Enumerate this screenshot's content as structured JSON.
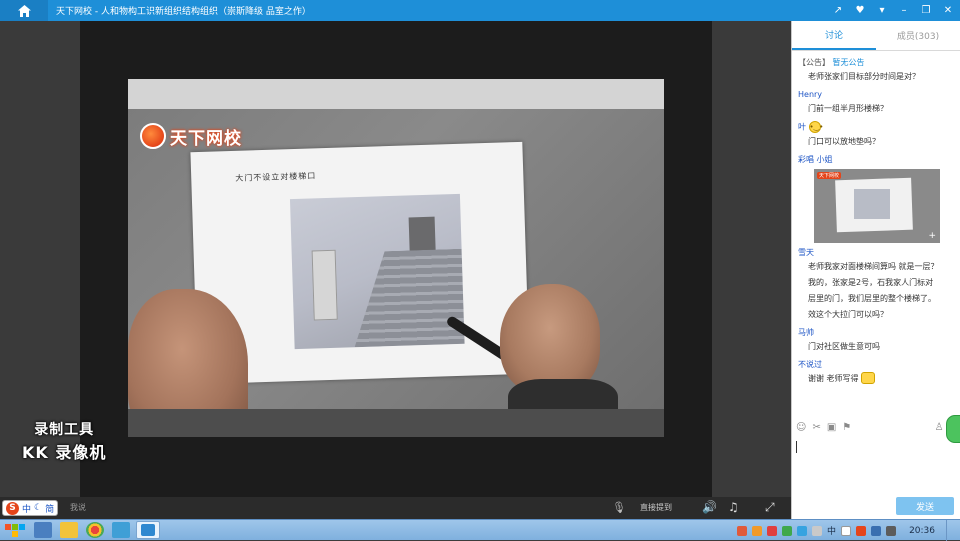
{
  "window": {
    "title": "天下网校 - 人和物构工识新组织结构组织（崇斯降级 品室之作）",
    "controls": [
      "share-icon",
      "heart-icon",
      "dropdown-icon",
      "minimize-icon",
      "restore-icon",
      "close-icon"
    ]
  },
  "video": {
    "logo_text": "天下网校",
    "paper_caption": "大门不设立对楼梯口",
    "watermark_line1": "录制工具",
    "watermark_line2": "KK 录像机"
  },
  "player": {
    "hint_text": "我说",
    "mode_label": "直接提到",
    "ime": {
      "mode": "中",
      "simplified": "简"
    }
  },
  "chat": {
    "tabs": [
      {
        "label": "讨论",
        "active": true
      },
      {
        "label": "成员(303)",
        "active": false
      }
    ],
    "notice": {
      "tag": "【公告】",
      "title": "暂无公告"
    },
    "messages": [
      {
        "name": "",
        "text": "老师张家们目标部分时间是对？"
      },
      {
        "name": "Henry",
        "text": "门前一组半月形楼梯？"
      },
      {
        "name": "叶",
        "text": ""
      },
      {
        "name": "",
        "text": "门口可以放地垫吗？"
      },
      {
        "name": "彩唱 小姐",
        "text": ""
      },
      {
        "name": "雪天",
        "text": "老师我家对面楼梯间算吗 就是一层？"
      },
      {
        "name": "",
        "text": "我的，张家是2号，石我家人门标对"
      },
      {
        "name": "",
        "text": "层里的门，我们层里的整个楼梯了。"
      },
      {
        "name": "",
        "text": "效这个大拉门可以吗？"
      },
      {
        "name": "马帅",
        "text": "门对社区做生意可吗"
      },
      {
        "name": "不说过",
        "text": "谢谢 老师写得"
      }
    ],
    "send_label": "发送"
  },
  "taskbar": {
    "clock": "20:36",
    "tray_labels": [
      "中",
      "S"
    ]
  }
}
